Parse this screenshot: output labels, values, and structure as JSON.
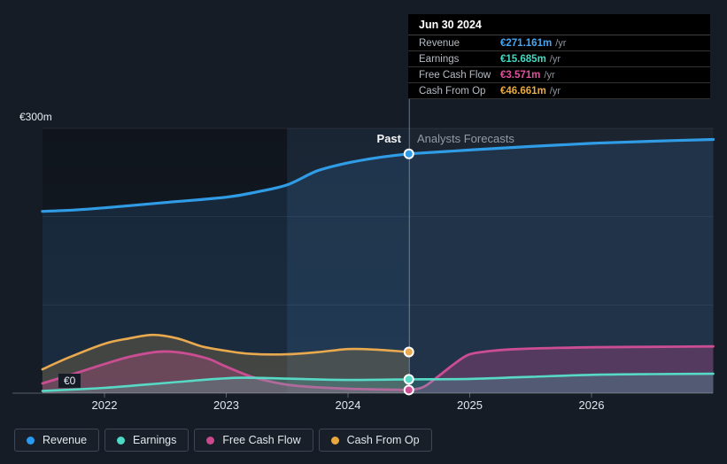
{
  "page": {
    "background": "#151c26"
  },
  "tooltip": {
    "date": "Jun 30 2024",
    "rows": [
      {
        "label": "Revenue",
        "value": "€271.161m",
        "suffix": "/yr",
        "color": "#45a6f3"
      },
      {
        "label": "Earnings",
        "value": "€15.685m",
        "suffix": "/yr",
        "color": "#45d9c2"
      },
      {
        "label": "Free Cash Flow",
        "value": "€3.571m",
        "suffix": "/yr",
        "color": "#e0519e"
      },
      {
        "label": "Cash From Op",
        "value": "€46.661m",
        "suffix": "/yr",
        "color": "#ebaa42"
      }
    ]
  },
  "sections": {
    "past_label": "Past",
    "forecast_label": "Analysts Forecasts"
  },
  "axis": {
    "y_top_label": "€300m",
    "y_zero_label": "€0"
  },
  "legend": [
    {
      "label": "Revenue",
      "color": "#2a9af0"
    },
    {
      "label": "Earnings",
      "color": "#4ed9c6"
    },
    {
      "label": "Free Cash Flow",
      "color": "#c9488e"
    },
    {
      "label": "Cash From Op",
      "color": "#e8a83e"
    }
  ],
  "chart_data": {
    "type": "area",
    "title": "",
    "x_axis": {
      "unit": "year",
      "ticks": [
        2022,
        2023,
        2024,
        2025,
        2026
      ],
      "range": [
        2021.49,
        2027.0
      ]
    },
    "y_axis": {
      "unit": "€m",
      "range": [
        0,
        300
      ],
      "gridlines": [
        0,
        100,
        200,
        300
      ],
      "labeled_gridlines": [
        0,
        300
      ]
    },
    "divider_x": 2024.5,
    "divider_date": "Jun 30 2024",
    "highlight_band": [
      2023.5,
      2024.5
    ],
    "legend_position": "bottom-left",
    "series": [
      {
        "name": "Revenue",
        "color": "#2f9ce5",
        "fill": "rgba(58,140,215,0.15)",
        "width": 3.2,
        "past": [
          [
            2021.49,
            206
          ],
          [
            2021.75,
            207.5
          ],
          [
            2022,
            210
          ],
          [
            2022.5,
            216
          ],
          [
            2023,
            222
          ],
          [
            2023.25,
            228
          ],
          [
            2023.5,
            236
          ],
          [
            2023.75,
            252
          ],
          [
            2024,
            261
          ],
          [
            2024.25,
            267
          ],
          [
            2024.5,
            271.161
          ]
        ],
        "forecast": [
          [
            2024.5,
            271.161
          ],
          [
            2025,
            275.5
          ],
          [
            2025.5,
            279.5
          ],
          [
            2026,
            283
          ],
          [
            2026.5,
            285.5
          ],
          [
            2027,
            287.5
          ]
        ]
      },
      {
        "name": "Cash From Op",
        "color": "#e9a94e",
        "fill": "rgba(214,165,80,0.22)",
        "width": 2.6,
        "past": [
          [
            2021.49,
            27
          ],
          [
            2021.7,
            40
          ],
          [
            2022,
            56
          ],
          [
            2022.2,
            62
          ],
          [
            2022.4,
            66
          ],
          [
            2022.6,
            62
          ],
          [
            2022.8,
            53
          ],
          [
            2023,
            48
          ],
          [
            2023.2,
            44.5
          ],
          [
            2023.5,
            44
          ],
          [
            2023.75,
            46.5
          ],
          [
            2024,
            50
          ],
          [
            2024.2,
            49.5
          ],
          [
            2024.5,
            46.661
          ]
        ],
        "forecast": []
      },
      {
        "name": "Free Cash Flow",
        "color": "#cb4d92",
        "fill": "rgba(203,77,146,0.30)",
        "width": 2.8,
        "past": [
          [
            2021.49,
            11
          ],
          [
            2021.75,
            22
          ],
          [
            2022,
            33
          ],
          [
            2022.2,
            41
          ],
          [
            2022.45,
            47
          ],
          [
            2022.65,
            45.5
          ],
          [
            2022.85,
            39
          ],
          [
            2023,
            30
          ],
          [
            2023.2,
            19
          ],
          [
            2023.4,
            12
          ],
          [
            2023.6,
            8
          ],
          [
            2024,
            5
          ],
          [
            2024.25,
            4.2
          ],
          [
            2024.5,
            3.571
          ]
        ],
        "forecast": [
          [
            2024.5,
            3.571
          ],
          [
            2024.62,
            7
          ],
          [
            2024.75,
            20
          ],
          [
            2024.9,
            36
          ],
          [
            2025,
            44
          ],
          [
            2025.15,
            47.5
          ],
          [
            2025.4,
            50
          ],
          [
            2026,
            52
          ],
          [
            2026.5,
            52.5
          ],
          [
            2027,
            53
          ]
        ]
      },
      {
        "name": "Earnings",
        "color": "#57d9c6",
        "fill": "rgba(80,210,190,0.22)",
        "width": 2.6,
        "past": [
          [
            2021.49,
            2.5
          ],
          [
            2022,
            6
          ],
          [
            2022.5,
            11.5
          ],
          [
            2022.9,
            16
          ],
          [
            2023.15,
            17.5
          ],
          [
            2023.5,
            16.5
          ],
          [
            2024,
            15
          ],
          [
            2024.5,
            15.685
          ]
        ],
        "forecast": [
          [
            2024.5,
            15.685
          ],
          [
            2025,
            16.2
          ],
          [
            2025.5,
            18.5
          ],
          [
            2026,
            20.8
          ],
          [
            2026.5,
            21.6
          ],
          [
            2027,
            22
          ]
        ]
      }
    ]
  }
}
